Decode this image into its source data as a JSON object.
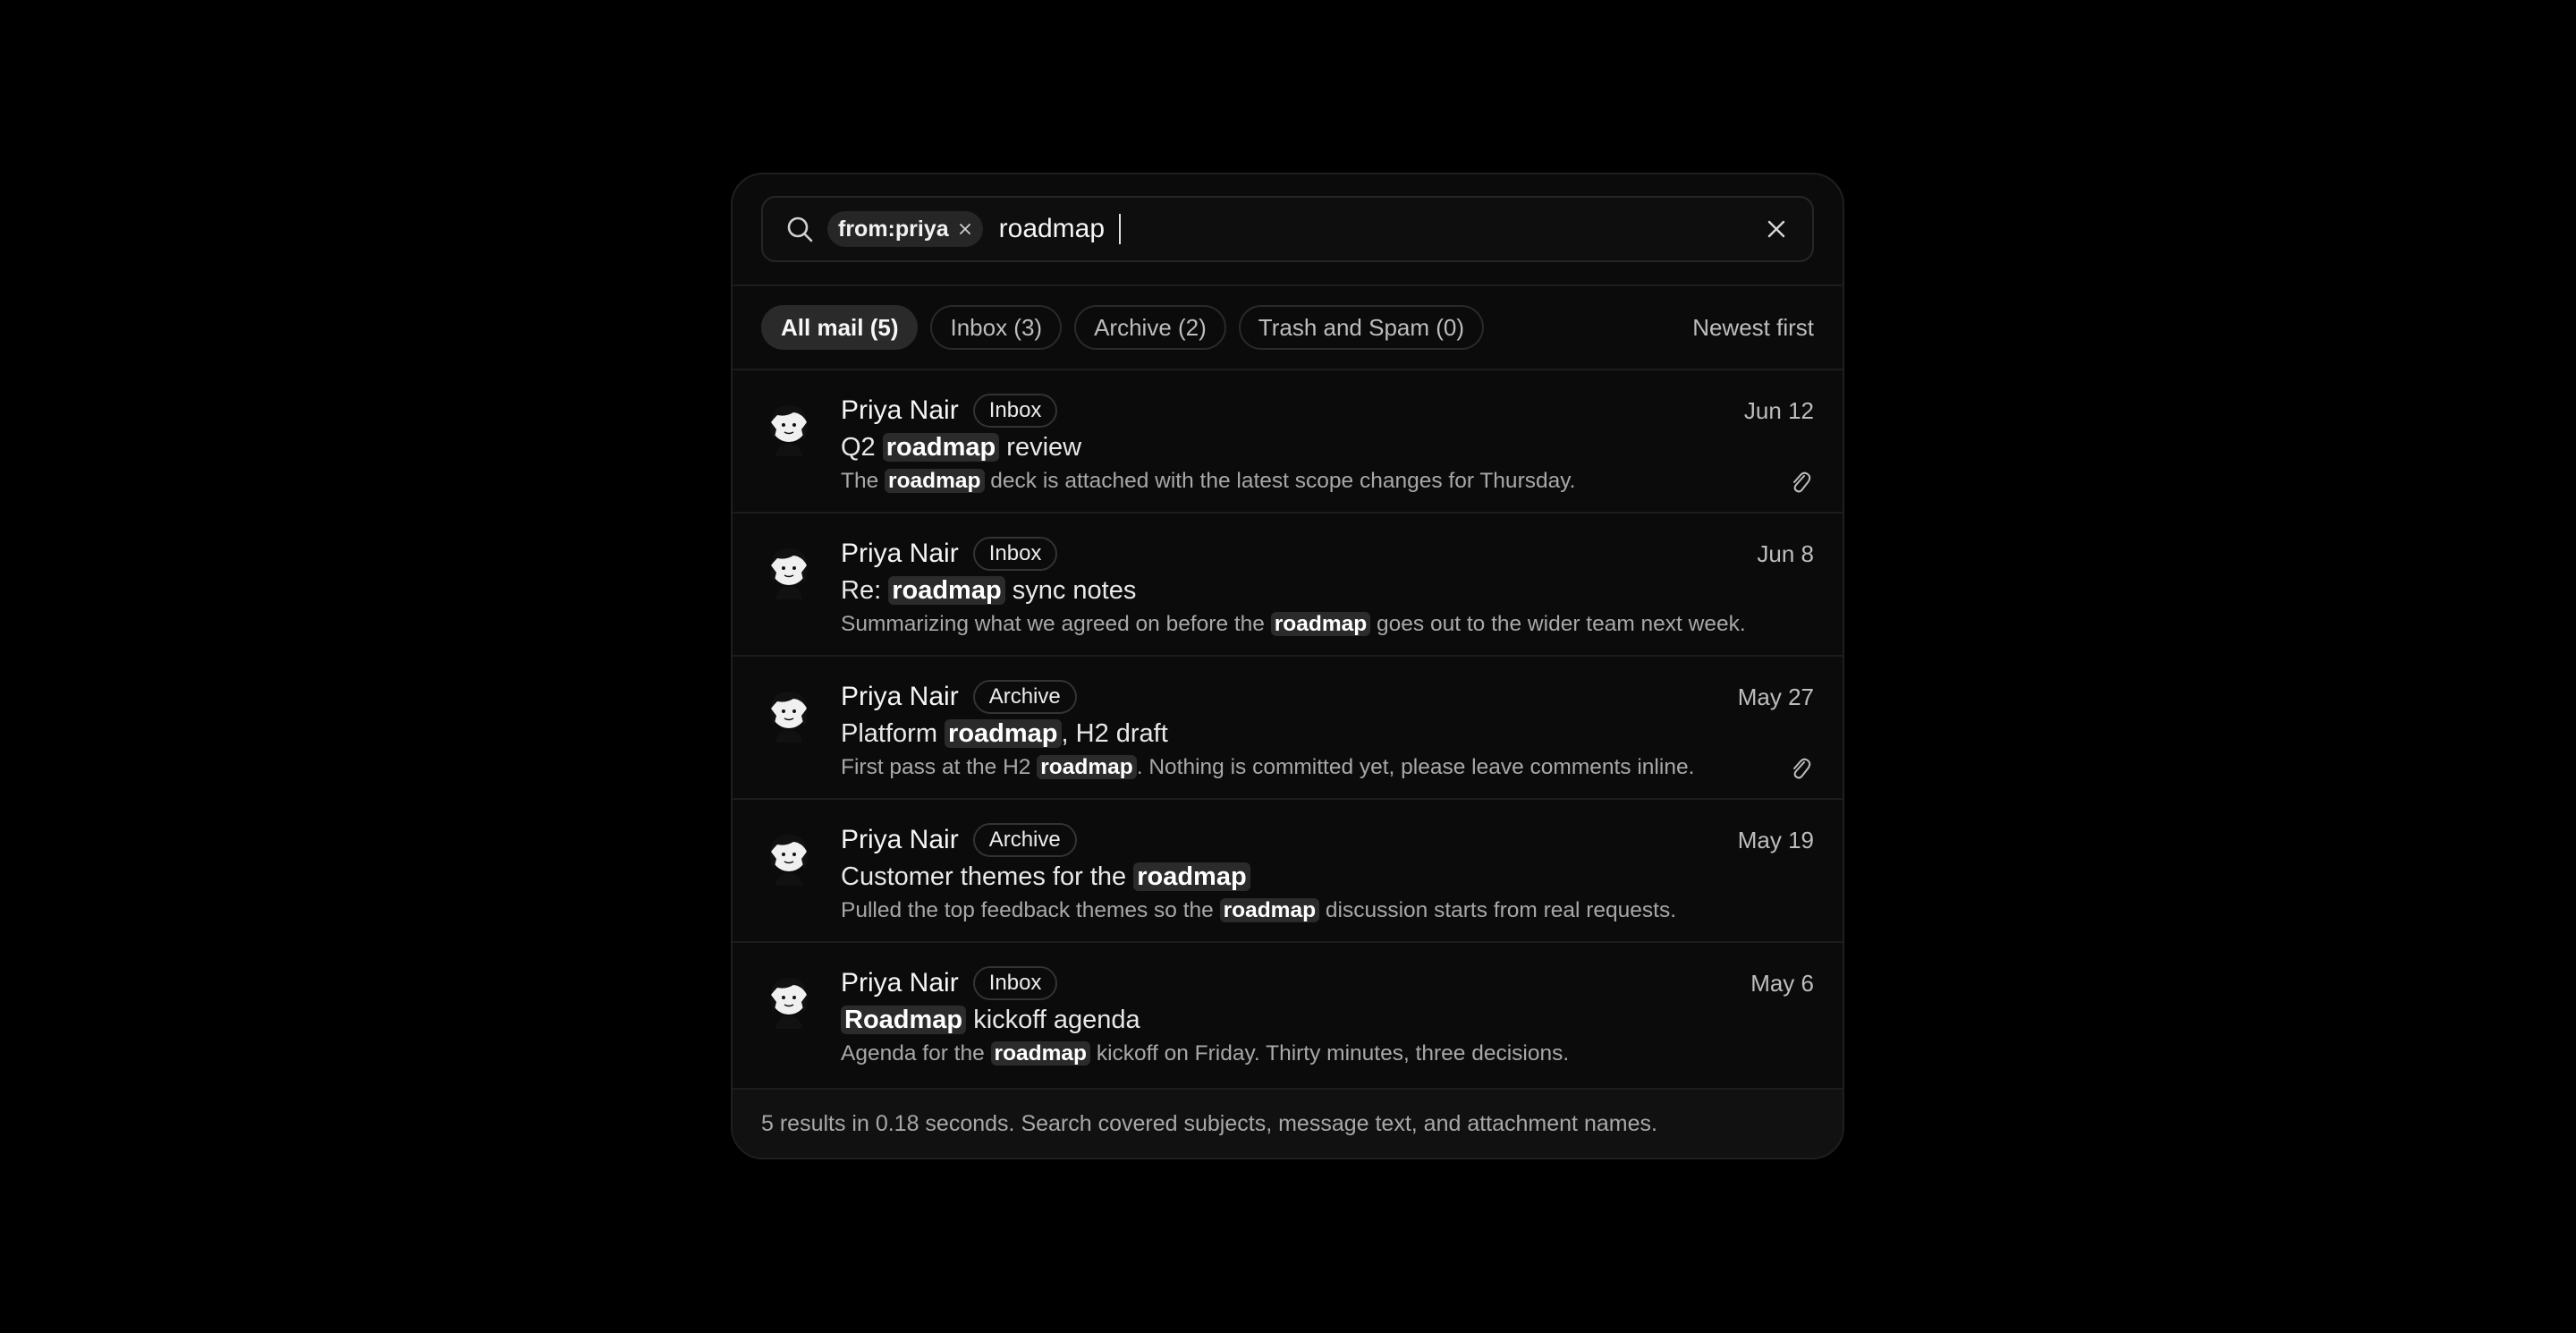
{
  "search": {
    "chip_label": "from:priya",
    "query": "roadmap"
  },
  "filters": {
    "tabs": [
      {
        "label": "All mail (5)",
        "active": true
      },
      {
        "label": "Inbox (3)",
        "active": false
      },
      {
        "label": "Archive (2)",
        "active": false
      },
      {
        "label": "Trash and Spam (0)",
        "active": false
      }
    ],
    "sort_label": "Newest first"
  },
  "results": [
    {
      "sender": "Priya Nair",
      "folder": "Inbox",
      "date": "Jun 12",
      "subject": {
        "before": "Q2 ",
        "match": "roadmap",
        "after": " review"
      },
      "preview": {
        "before": "The ",
        "match": "roadmap",
        "after": " deck is attached with the latest scope changes for Thursday."
      },
      "has_attachment": true
    },
    {
      "sender": "Priya Nair",
      "folder": "Inbox",
      "date": "Jun 8",
      "subject": {
        "before": "Re: ",
        "match": "roadmap",
        "after": " sync notes"
      },
      "preview": {
        "before": "Summarizing what we agreed on before the ",
        "match": "roadmap",
        "after": " goes out to the wider team next week."
      },
      "has_attachment": false
    },
    {
      "sender": "Priya Nair",
      "folder": "Archive",
      "date": "May 27",
      "subject": {
        "before": "Platform ",
        "match": "roadmap",
        "after": ", H2 draft"
      },
      "preview": {
        "before": "First pass at the H2 ",
        "match": "roadmap",
        "after": ". Nothing is committed yet, please leave comments inline."
      },
      "has_attachment": true
    },
    {
      "sender": "Priya Nair",
      "folder": "Archive",
      "date": "May 19",
      "subject": {
        "before": "Customer themes for the ",
        "match": "roadmap",
        "after": ""
      },
      "preview": {
        "before": "Pulled the top feedback themes so the ",
        "match": "roadmap",
        "after": " discussion starts from real requests."
      },
      "has_attachment": false
    },
    {
      "sender": "Priya Nair",
      "folder": "Inbox",
      "date": "May 6",
      "subject": {
        "before": "",
        "match": "Roadmap",
        "after": " kickoff agenda"
      },
      "preview": {
        "before": "Agenda for the ",
        "match": "roadmap",
        "after": " kickoff on Friday. Thirty minutes, three decisions."
      },
      "has_attachment": false
    }
  ],
  "footer": {
    "summary": "5 results in 0.18 seconds. Search covered subjects, message text, and attachment names."
  },
  "icons": {
    "search": "search-icon",
    "chip_remove": "close-icon",
    "clear": "close-icon",
    "attachment": "paperclip-icon",
    "avatar": "avatar-illustration"
  }
}
